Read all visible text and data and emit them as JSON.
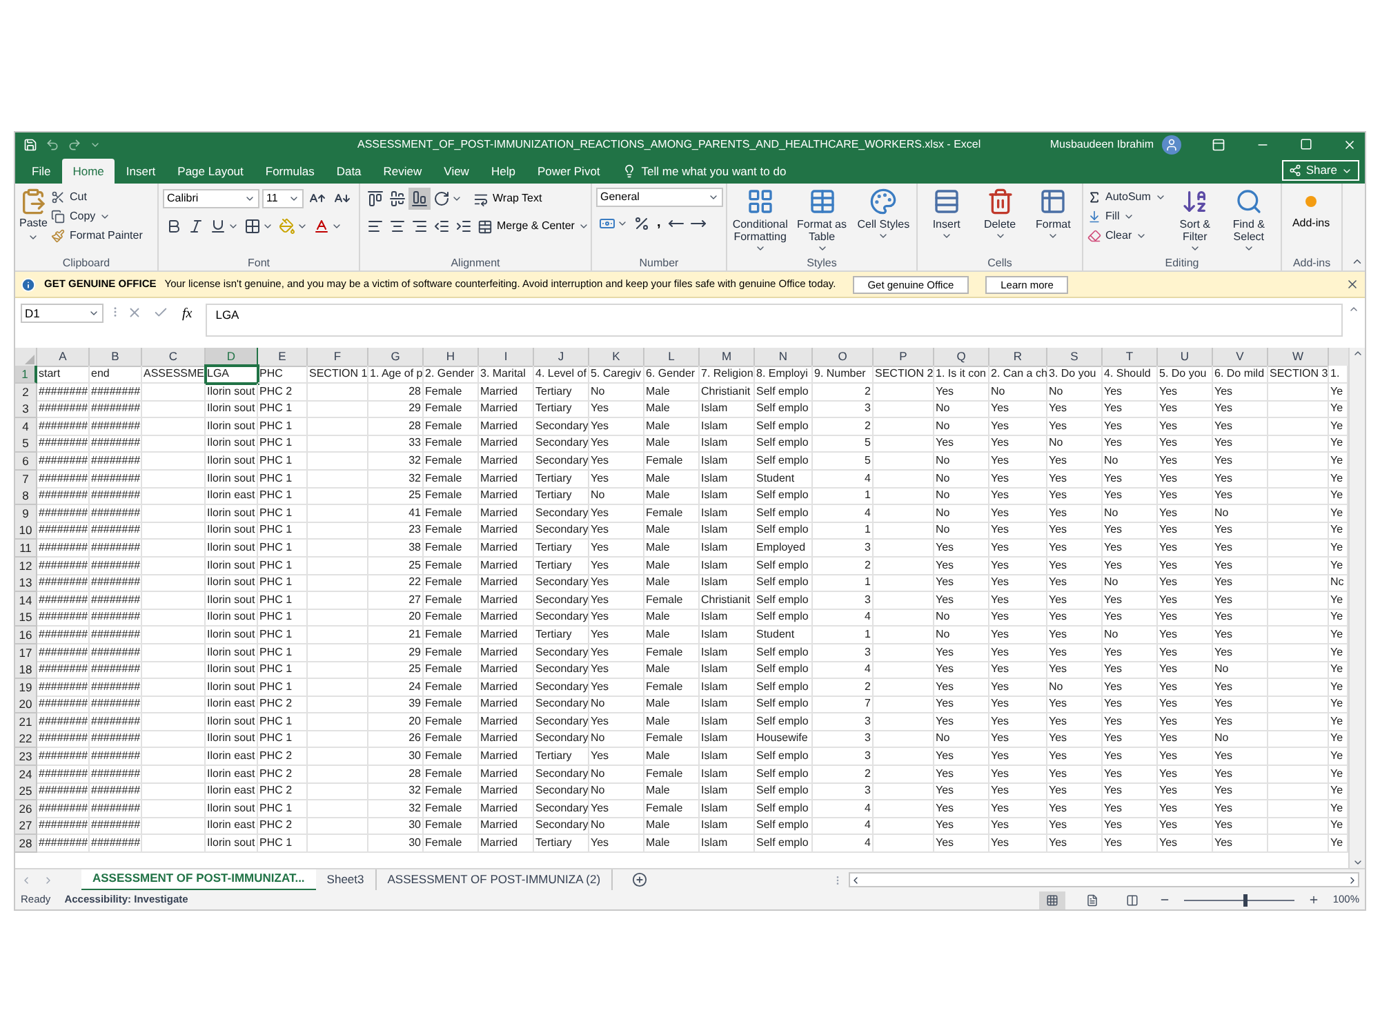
{
  "title_bar": {
    "title": "ASSESSMENT_OF_POST-IMMUNIZATION_REACTIONS_AMONG_PARENTS_AND_HEALTHCARE_WORKERS.xlsx  -  Excel",
    "user": "Musbaudeen Ibrahim"
  },
  "menu_tabs": [
    {
      "label": "File",
      "selected": false
    },
    {
      "label": "Home",
      "selected": true
    },
    {
      "label": "Insert",
      "selected": false
    },
    {
      "label": "Page Layout",
      "selected": false
    },
    {
      "label": "Formulas",
      "selected": false
    },
    {
      "label": "Data",
      "selected": false
    },
    {
      "label": "Review",
      "selected": false
    },
    {
      "label": "View",
      "selected": false
    },
    {
      "label": "Help",
      "selected": false
    },
    {
      "label": "Power Pivot",
      "selected": false
    }
  ],
  "tell_me": "Tell me what you want to do",
  "share": "Share",
  "ribbon": {
    "clipboard": {
      "label": "Clipboard",
      "paste": "Paste",
      "cut": "Cut",
      "copy": "Copy",
      "format_painter": "Format Painter"
    },
    "font": {
      "label": "Font",
      "font_name": "Calibri",
      "font_size": "11"
    },
    "alignment": {
      "label": "Alignment",
      "wrap_text": "Wrap Text",
      "merge_center": "Merge & Center"
    },
    "number": {
      "label": "Number",
      "format": "General",
      "comma": ","
    },
    "styles": {
      "label": "Styles",
      "buttons": [
        "Conditional Formatting",
        "Format as Table",
        "Cell Styles"
      ]
    },
    "cells": {
      "label": "Cells",
      "buttons": [
        "Insert",
        "Delete",
        "Format"
      ]
    },
    "editing": {
      "label": "Editing",
      "autosum": "AutoSum",
      "fill": "Fill",
      "clear": "Clear",
      "sort_filter": "Sort & Filter",
      "find_select": "Find & Select"
    },
    "addins": {
      "label": "Add-ins",
      "button": "Add-ins"
    }
  },
  "message_bar": {
    "title": "GET GENUINE OFFICE",
    "text": "Your license isn't genuine, and you may be a victim of software counterfeiting. Avoid interruption and keep your files safe with genuine Office today.",
    "buttons": [
      "Get genuine Office",
      "Learn more"
    ]
  },
  "formula_bar": {
    "name_box": "D1",
    "fx": "fx",
    "formula": "LGA"
  },
  "sheet": {
    "columns": [
      {
        "label": "A",
        "selected": false
      },
      {
        "label": "B",
        "selected": false
      },
      {
        "label": "C",
        "selected": false
      },
      {
        "label": "D",
        "selected": true
      },
      {
        "label": "E",
        "selected": false
      },
      {
        "label": "F",
        "selected": false
      },
      {
        "label": "G",
        "selected": false
      },
      {
        "label": "H",
        "selected": false
      },
      {
        "label": "I",
        "selected": false
      },
      {
        "label": "J",
        "selected": false
      },
      {
        "label": "K",
        "selected": false
      },
      {
        "label": "L",
        "selected": false
      },
      {
        "label": "M",
        "selected": false
      },
      {
        "label": "N",
        "selected": false
      },
      {
        "label": "O",
        "selected": false
      },
      {
        "label": "P",
        "selected": false
      },
      {
        "label": "Q",
        "selected": false
      },
      {
        "label": "R",
        "selected": false
      },
      {
        "label": "S",
        "selected": false
      },
      {
        "label": "T",
        "selected": false
      },
      {
        "label": "U",
        "selected": false
      },
      {
        "label": "V",
        "selected": false
      },
      {
        "label": "W",
        "selected": false
      }
    ],
    "rows": [
      {
        "number": "1",
        "selected": true,
        "cells": [
          "start",
          "end",
          "ASSESSME",
          "LGA",
          "PHC",
          "SECTION 1",
          "1. Age of p",
          "2. Gender",
          "3. Marital",
          "4. Level of",
          "5. Caregiv",
          "6. Gender",
          "7. Religion",
          "8. Employi",
          "9. Number",
          "SECTION 2",
          "1. Is it con",
          "2. Can a ch",
          "3. Do you",
          "4. Should",
          "5. Do you",
          "6. Do mild",
          "SECTION 3",
          "1."
        ]
      },
      {
        "number": "2",
        "selected": false,
        "cells": [
          "########",
          "########",
          null,
          "Ilorin sout",
          "PHC 2",
          null,
          "28",
          "Female",
          "Married",
          "Tertiary",
          "No",
          "Male",
          "Christianit",
          "Self emplo",
          "2",
          null,
          "Yes",
          "No",
          "No",
          "Yes",
          "Yes",
          "Yes",
          null,
          "Ye"
        ]
      },
      {
        "number": "3",
        "selected": false,
        "cells": [
          "########",
          "########",
          null,
          "Ilorin sout",
          "PHC 1",
          null,
          "29",
          "Female",
          "Married",
          "Tertiary",
          "Yes",
          "Male",
          "Islam",
          "Self emplo",
          "3",
          null,
          "No",
          "Yes",
          "Yes",
          "Yes",
          "Yes",
          "Yes",
          null,
          "Ye"
        ]
      },
      {
        "number": "4",
        "selected": false,
        "cells": [
          "########",
          "########",
          null,
          "Ilorin sout",
          "PHC 1",
          null,
          "28",
          "Female",
          "Married",
          "Secondary",
          "Yes",
          "Male",
          "Islam",
          "Self emplo",
          "2",
          null,
          "No",
          "Yes",
          "Yes",
          "Yes",
          "Yes",
          "Yes",
          null,
          "Ye"
        ]
      },
      {
        "number": "5",
        "selected": false,
        "cells": [
          "########",
          "########",
          null,
          "Ilorin sout",
          "PHC 1",
          null,
          "33",
          "Female",
          "Married",
          "Secondary",
          "Yes",
          "Male",
          "Islam",
          "Self emplo",
          "5",
          null,
          "Yes",
          "Yes",
          "No",
          "Yes",
          "Yes",
          "Yes",
          null,
          "Ye"
        ]
      },
      {
        "number": "6",
        "selected": false,
        "cells": [
          "########",
          "########",
          null,
          "Ilorin sout",
          "PHC 1",
          null,
          "32",
          "Female",
          "Married",
          "Secondary",
          "Yes",
          "Female",
          "Islam",
          "Self emplo",
          "5",
          null,
          "No",
          "Yes",
          "Yes",
          "No",
          "Yes",
          "Yes",
          null,
          "Ye"
        ]
      },
      {
        "number": "7",
        "selected": false,
        "cells": [
          "########",
          "########",
          null,
          "Ilorin sout",
          "PHC 1",
          null,
          "32",
          "Female",
          "Married",
          "Tertiary",
          "Yes",
          "Male",
          "Islam",
          "Student",
          "4",
          null,
          "No",
          "Yes",
          "Yes",
          "Yes",
          "Yes",
          "Yes",
          null,
          "Ye"
        ]
      },
      {
        "number": "8",
        "selected": false,
        "cells": [
          "########",
          "########",
          null,
          "Ilorin east",
          "PHC 1",
          null,
          "25",
          "Female",
          "Married",
          "Tertiary",
          "No",
          "Male",
          "Islam",
          "Self emplo",
          "1",
          null,
          "No",
          "Yes",
          "Yes",
          "Yes",
          "Yes",
          "Yes",
          null,
          "Ye"
        ]
      },
      {
        "number": "9",
        "selected": false,
        "cells": [
          "########",
          "########",
          null,
          "Ilorin sout",
          "PHC 1",
          null,
          "41",
          "Female",
          "Married",
          "Secondary",
          "Yes",
          "Female",
          "Islam",
          "Self emplo",
          "4",
          null,
          "No",
          "Yes",
          "Yes",
          "No",
          "Yes",
          "No",
          null,
          "Ye"
        ]
      },
      {
        "number": "10",
        "selected": false,
        "cells": [
          "########",
          "########",
          null,
          "Ilorin sout",
          "PHC 1",
          null,
          "23",
          "Female",
          "Married",
          "Secondary",
          "Yes",
          "Male",
          "Islam",
          "Self emplo",
          "1",
          null,
          "No",
          "Yes",
          "Yes",
          "Yes",
          "Yes",
          "Yes",
          null,
          "Ye"
        ]
      },
      {
        "number": "11",
        "selected": false,
        "cells": [
          "########",
          "########",
          null,
          "Ilorin sout",
          "PHC 1",
          null,
          "38",
          "Female",
          "Married",
          "Tertiary",
          "Yes",
          "Male",
          "Islam",
          "Employed",
          "3",
          null,
          "Yes",
          "Yes",
          "Yes",
          "Yes",
          "Yes",
          "Yes",
          null,
          "Ye"
        ]
      },
      {
        "number": "12",
        "selected": false,
        "cells": [
          "########",
          "########",
          null,
          "Ilorin sout",
          "PHC 1",
          null,
          "25",
          "Female",
          "Married",
          "Tertiary",
          "Yes",
          "Male",
          "Islam",
          "Self emplo",
          "2",
          null,
          "Yes",
          "Yes",
          "Yes",
          "Yes",
          "Yes",
          "Yes",
          null,
          "Ye"
        ]
      },
      {
        "number": "13",
        "selected": false,
        "cells": [
          "########",
          "########",
          null,
          "Ilorin sout",
          "PHC 1",
          null,
          "22",
          "Female",
          "Married",
          "Secondary",
          "Yes",
          "Male",
          "Islam",
          "Self emplo",
          "1",
          null,
          "Yes",
          "Yes",
          "Yes",
          "No",
          "Yes",
          "Yes",
          null,
          "Nc"
        ]
      },
      {
        "number": "14",
        "selected": false,
        "cells": [
          "########",
          "########",
          null,
          "Ilorin sout",
          "PHC 1",
          null,
          "27",
          "Female",
          "Married",
          "Secondary",
          "Yes",
          "Female",
          "Christianit",
          "Self emplo",
          "3",
          null,
          "Yes",
          "Yes",
          "Yes",
          "Yes",
          "Yes",
          "Yes",
          null,
          "Ye"
        ]
      },
      {
        "number": "15",
        "selected": false,
        "cells": [
          "########",
          "########",
          null,
          "Ilorin sout",
          "PHC 1",
          null,
          "20",
          "Female",
          "Married",
          "Secondary",
          "Yes",
          "Male",
          "Islam",
          "Self emplo",
          "4",
          null,
          "No",
          "Yes",
          "Yes",
          "Yes",
          "Yes",
          "Yes",
          null,
          "Ye"
        ]
      },
      {
        "number": "16",
        "selected": false,
        "cells": [
          "########",
          "########",
          null,
          "Ilorin sout",
          "PHC 1",
          null,
          "21",
          "Female",
          "Married",
          "Tertiary",
          "Yes",
          "Male",
          "Islam",
          "Student",
          "1",
          null,
          "No",
          "Yes",
          "Yes",
          "No",
          "Yes",
          "Yes",
          null,
          "Ye"
        ]
      },
      {
        "number": "17",
        "selected": false,
        "cells": [
          "########",
          "########",
          null,
          "Ilorin sout",
          "PHC 1",
          null,
          "29",
          "Female",
          "Married",
          "Secondary",
          "Yes",
          "Female",
          "Islam",
          "Self emplo",
          "3",
          null,
          "Yes",
          "Yes",
          "Yes",
          "Yes",
          "Yes",
          "Yes",
          null,
          "Ye"
        ]
      },
      {
        "number": "18",
        "selected": false,
        "cells": [
          "########",
          "########",
          null,
          "Ilorin sout",
          "PHC 1",
          null,
          "25",
          "Female",
          "Married",
          "Secondary",
          "Yes",
          "Male",
          "Islam",
          "Self emplo",
          "4",
          null,
          "Yes",
          "Yes",
          "Yes",
          "Yes",
          "Yes",
          "No",
          null,
          "Ye"
        ]
      },
      {
        "number": "19",
        "selected": false,
        "cells": [
          "########",
          "########",
          null,
          "Ilorin sout",
          "PHC 1",
          null,
          "24",
          "Female",
          "Married",
          "Secondary",
          "Yes",
          "Female",
          "Islam",
          "Self emplo",
          "2",
          null,
          "Yes",
          "Yes",
          "No",
          "Yes",
          "Yes",
          "Yes",
          null,
          "Ye"
        ]
      },
      {
        "number": "20",
        "selected": false,
        "cells": [
          "########",
          "########",
          null,
          "Ilorin east",
          "PHC 2",
          null,
          "39",
          "Female",
          "Married",
          "Secondary",
          "No",
          "Male",
          "Islam",
          "Self emplo",
          "7",
          null,
          "Yes",
          "Yes",
          "Yes",
          "Yes",
          "Yes",
          "Yes",
          null,
          "Ye"
        ]
      },
      {
        "number": "21",
        "selected": false,
        "cells": [
          "########",
          "########",
          null,
          "Ilorin sout",
          "PHC 1",
          null,
          "20",
          "Female",
          "Married",
          "Secondary",
          "Yes",
          "Male",
          "Islam",
          "Self emplo",
          "3",
          null,
          "Yes",
          "Yes",
          "Yes",
          "Yes",
          "Yes",
          "Yes",
          null,
          "Ye"
        ]
      },
      {
        "number": "22",
        "selected": false,
        "cells": [
          "########",
          "########",
          null,
          "Ilorin sout",
          "PHC 1",
          null,
          "26",
          "Female",
          "Married",
          "Secondary",
          "No",
          "Female",
          "Islam",
          "Housewife",
          "3",
          null,
          "No",
          "Yes",
          "Yes",
          "Yes",
          "Yes",
          "No",
          null,
          "Ye"
        ]
      },
      {
        "number": "23",
        "selected": false,
        "cells": [
          "########",
          "########",
          null,
          "Ilorin east",
          "PHC 2",
          null,
          "30",
          "Female",
          "Married",
          "Tertiary",
          "Yes",
          "Male",
          "Islam",
          "Self emplo",
          "3",
          null,
          "Yes",
          "Yes",
          "Yes",
          "Yes",
          "Yes",
          "Yes",
          null,
          "Ye"
        ]
      },
      {
        "number": "24",
        "selected": false,
        "cells": [
          "########",
          "########",
          null,
          "Ilorin east",
          "PHC 2",
          null,
          "28",
          "Female",
          "Married",
          "Secondary",
          "No",
          "Female",
          "Islam",
          "Self emplo",
          "2",
          null,
          "Yes",
          "Yes",
          "Yes",
          "Yes",
          "Yes",
          "Yes",
          null,
          "Ye"
        ]
      },
      {
        "number": "25",
        "selected": false,
        "cells": [
          "########",
          "########",
          null,
          "Ilorin east",
          "PHC 2",
          null,
          "32",
          "Female",
          "Married",
          "Secondary",
          "No",
          "Male",
          "Islam",
          "Self emplo",
          "3",
          null,
          "Yes",
          "Yes",
          "Yes",
          "Yes",
          "Yes",
          "Yes",
          null,
          "Ye"
        ]
      },
      {
        "number": "26",
        "selected": false,
        "cells": [
          "########",
          "########",
          null,
          "Ilorin sout",
          "PHC 1",
          null,
          "32",
          "Female",
          "Married",
          "Secondary",
          "Yes",
          "Female",
          "Islam",
          "Self emplo",
          "4",
          null,
          "Yes",
          "Yes",
          "Yes",
          "Yes",
          "Yes",
          "Yes",
          null,
          "Ye"
        ]
      },
      {
        "number": "27",
        "selected": false,
        "cells": [
          "########",
          "########",
          null,
          "Ilorin east",
          "PHC 2",
          null,
          "30",
          "Female",
          "Married",
          "Secondary",
          "No",
          "Male",
          "Islam",
          "Self emplo",
          "4",
          null,
          "Yes",
          "Yes",
          "Yes",
          "Yes",
          "Yes",
          "Yes",
          null,
          "Ye"
        ]
      },
      {
        "number": "28",
        "selected": false,
        "cells": [
          "########",
          "########",
          null,
          "Ilorin sout",
          "PHC 1",
          null,
          "30",
          "Female",
          "Married",
          "Tertiary",
          "Yes",
          "Male",
          "Islam",
          "Self emplo",
          "4",
          null,
          "Yes",
          "Yes",
          "Yes",
          "Yes",
          "Yes",
          "Yes",
          null,
          "Ye"
        ]
      }
    ]
  },
  "sheet_tabs": [
    {
      "label": "ASSESSMENT OF POST-IMMUNIZAT...",
      "selected": true
    },
    {
      "label": "Sheet3",
      "selected": false
    },
    {
      "label": "ASSESSMENT OF POST-IMMUNIZA (2)",
      "selected": false
    }
  ],
  "status_bar": {
    "status": "Ready",
    "accessibility": "Accessibility: Investigate",
    "views": [
      {
        "kind": "normal",
        "selected": true
      },
      {
        "kind": "page_layout",
        "selected": false
      },
      {
        "kind": "page_break",
        "selected": false
      }
    ],
    "zoom": {
      "level": 0.55,
      "reading": "100%"
    }
  }
}
